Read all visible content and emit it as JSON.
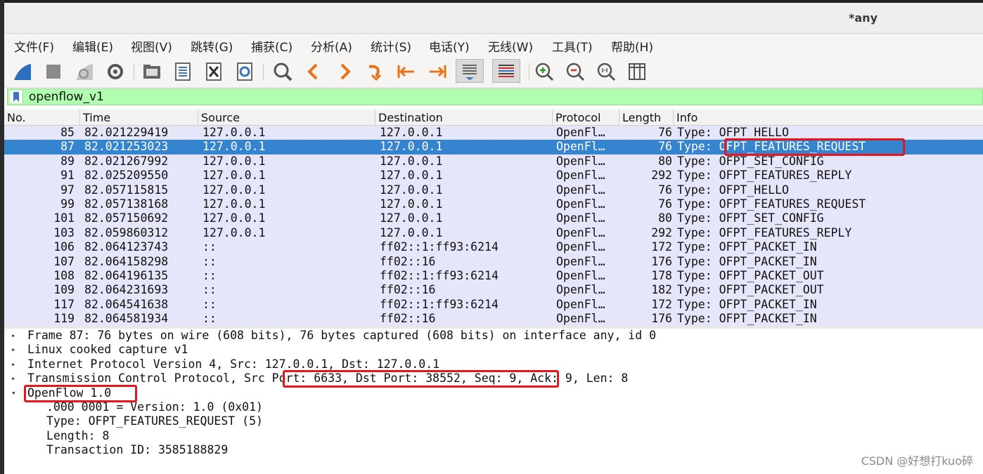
{
  "window": {
    "title": "*any"
  },
  "menu": [
    "文件(F)",
    "编辑(E)",
    "视图(V)",
    "跳转(G)",
    "捕获(C)",
    "分析(A)",
    "统计(S)",
    "电话(Y)",
    "无线(W)",
    "工具(T)",
    "帮助(H)"
  ],
  "toolbar_icons": [
    "shark-fin-start-icon",
    "stop-capture-icon",
    "restart-capture-icon",
    "capture-options-icon",
    "open-file-icon",
    "save-file-icon",
    "close-file-icon",
    "reload-file-icon",
    "find-packet-icon",
    "go-back-icon",
    "go-forward-icon",
    "go-to-packet-icon",
    "go-first-icon",
    "go-last-icon",
    "autoscroll-icon",
    "colorize-icon",
    "zoom-in-icon",
    "zoom-out-icon",
    "normal-size-icon",
    "resize-columns-icon"
  ],
  "filter": {
    "value": "openflow_v1"
  },
  "columns": [
    "No.",
    "Time",
    "Source",
    "Destination",
    "Protocol",
    "Length",
    "Info"
  ],
  "packets": [
    {
      "no": "85",
      "time": "82.021229419",
      "src": "127.0.0.1",
      "dst": "127.0.0.1",
      "proto": "OpenFl…",
      "len": "76",
      "info": "Type: OFPT_HELLO"
    },
    {
      "no": "87",
      "time": "82.021253023",
      "src": "127.0.0.1",
      "dst": "127.0.0.1",
      "proto": "OpenFl…",
      "len": "76",
      "info": "Type: OFPT_FEATURES_REQUEST",
      "selected": true
    },
    {
      "no": "89",
      "time": "82.021267992",
      "src": "127.0.0.1",
      "dst": "127.0.0.1",
      "proto": "OpenFl…",
      "len": "80",
      "info": "Type: OFPT_SET_CONFIG"
    },
    {
      "no": "91",
      "time": "82.025209550",
      "src": "127.0.0.1",
      "dst": "127.0.0.1",
      "proto": "OpenFl…",
      "len": "292",
      "info": "Type: OFPT_FEATURES_REPLY"
    },
    {
      "no": "97",
      "time": "82.057115815",
      "src": "127.0.0.1",
      "dst": "127.0.0.1",
      "proto": "OpenFl…",
      "len": "76",
      "info": "Type: OFPT_HELLO"
    },
    {
      "no": "99",
      "time": "82.057138168",
      "src": "127.0.0.1",
      "dst": "127.0.0.1",
      "proto": "OpenFl…",
      "len": "76",
      "info": "Type: OFPT_FEATURES_REQUEST"
    },
    {
      "no": "101",
      "time": "82.057150692",
      "src": "127.0.0.1",
      "dst": "127.0.0.1",
      "proto": "OpenFl…",
      "len": "80",
      "info": "Type: OFPT_SET_CONFIG"
    },
    {
      "no": "103",
      "time": "82.059860312",
      "src": "127.0.0.1",
      "dst": "127.0.0.1",
      "proto": "OpenFl…",
      "len": "292",
      "info": "Type: OFPT_FEATURES_REPLY"
    },
    {
      "no": "106",
      "time": "82.064123743",
      "src": "::",
      "dst": "ff02::1:ff93:6214",
      "proto": "OpenFl…",
      "len": "172",
      "info": "Type: OFPT_PACKET_IN"
    },
    {
      "no": "107",
      "time": "82.064158298",
      "src": "::",
      "dst": "ff02::16",
      "proto": "OpenFl…",
      "len": "176",
      "info": "Type: OFPT_PACKET_IN"
    },
    {
      "no": "108",
      "time": "82.064196135",
      "src": "::",
      "dst": "ff02::1:ff93:6214",
      "proto": "OpenFl…",
      "len": "178",
      "info": "Type: OFPT_PACKET_OUT"
    },
    {
      "no": "109",
      "time": "82.064231693",
      "src": "::",
      "dst": "ff02::16",
      "proto": "OpenFl…",
      "len": "182",
      "info": "Type: OFPT_PACKET_OUT"
    },
    {
      "no": "117",
      "time": "82.064541638",
      "src": "::",
      "dst": "ff02::1:ff93:6214",
      "proto": "OpenFl…",
      "len": "172",
      "info": "Type: OFPT_PACKET_IN"
    },
    {
      "no": "119",
      "time": "82.064581934",
      "src": "::",
      "dst": "ff02::16",
      "proto": "OpenFl…",
      "len": "176",
      "info": "Type: OFPT_PACKET_IN"
    }
  ],
  "details": [
    {
      "expander": "collapsed",
      "text": "Frame 87: 76 bytes on wire (608 bits), 76 bytes captured (608 bits) on interface any, id 0"
    },
    {
      "expander": "collapsed",
      "text": "Linux cooked capture v1"
    },
    {
      "expander": "collapsed",
      "text": "Internet Protocol Version 4, Src: 127.0.0.1, Dst: 127.0.0.1"
    },
    {
      "expander": "collapsed",
      "text": "Transmission Control Protocol, Src Port: 6633, Dst Port: 38552, Seq: 9, Ack: 9, Len: 8"
    },
    {
      "expander": "expanded",
      "text": "OpenFlow 1.0"
    },
    {
      "expander": "none",
      "text": ".000 0001 = Version: 1.0 (0x01)"
    },
    {
      "expander": "none",
      "text": "Type: OFPT_FEATURES_REQUEST (5)"
    },
    {
      "expander": "none",
      "text": "Length: 8"
    },
    {
      "expander": "none",
      "text": "Transaction ID: 3585188829"
    }
  ],
  "watermark": "CSDN @好想打kuo碎",
  "colors": {
    "selected_row": "#3584d0",
    "row_bg": "#e6e6fa",
    "filter_bg": "#afffaf",
    "highlight": "#e8151d"
  }
}
